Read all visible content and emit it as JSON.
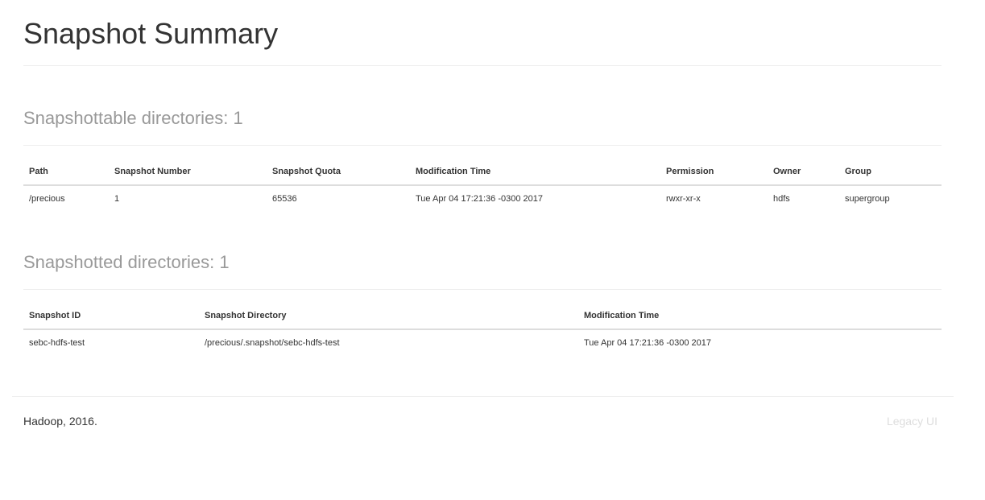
{
  "page": {
    "title": "Snapshot Summary"
  },
  "snapshottable": {
    "title": "Snapshottable directories: 1",
    "columns": [
      "Path",
      "Snapshot Number",
      "Snapshot Quota",
      "Modification Time",
      "Permission",
      "Owner",
      "Group"
    ],
    "rows": [
      [
        "/precious",
        "1",
        "65536",
        "Tue Apr 04 17:21:36 -0300 2017",
        "rwxr-xr-x",
        "hdfs",
        "supergroup"
      ]
    ]
  },
  "snapshotted": {
    "title": "Snapshotted directories: 1",
    "columns": [
      "Snapshot ID",
      "Snapshot Directory",
      "Modification Time"
    ],
    "rows": [
      [
        "sebc-hdfs-test",
        "/precious/.snapshot/sebc-hdfs-test",
        "Tue Apr 04 17:21:36 -0300 2017"
      ]
    ]
  },
  "footer": {
    "copyright": "Hadoop, 2016.",
    "legacy_link": "Legacy UI"
  }
}
